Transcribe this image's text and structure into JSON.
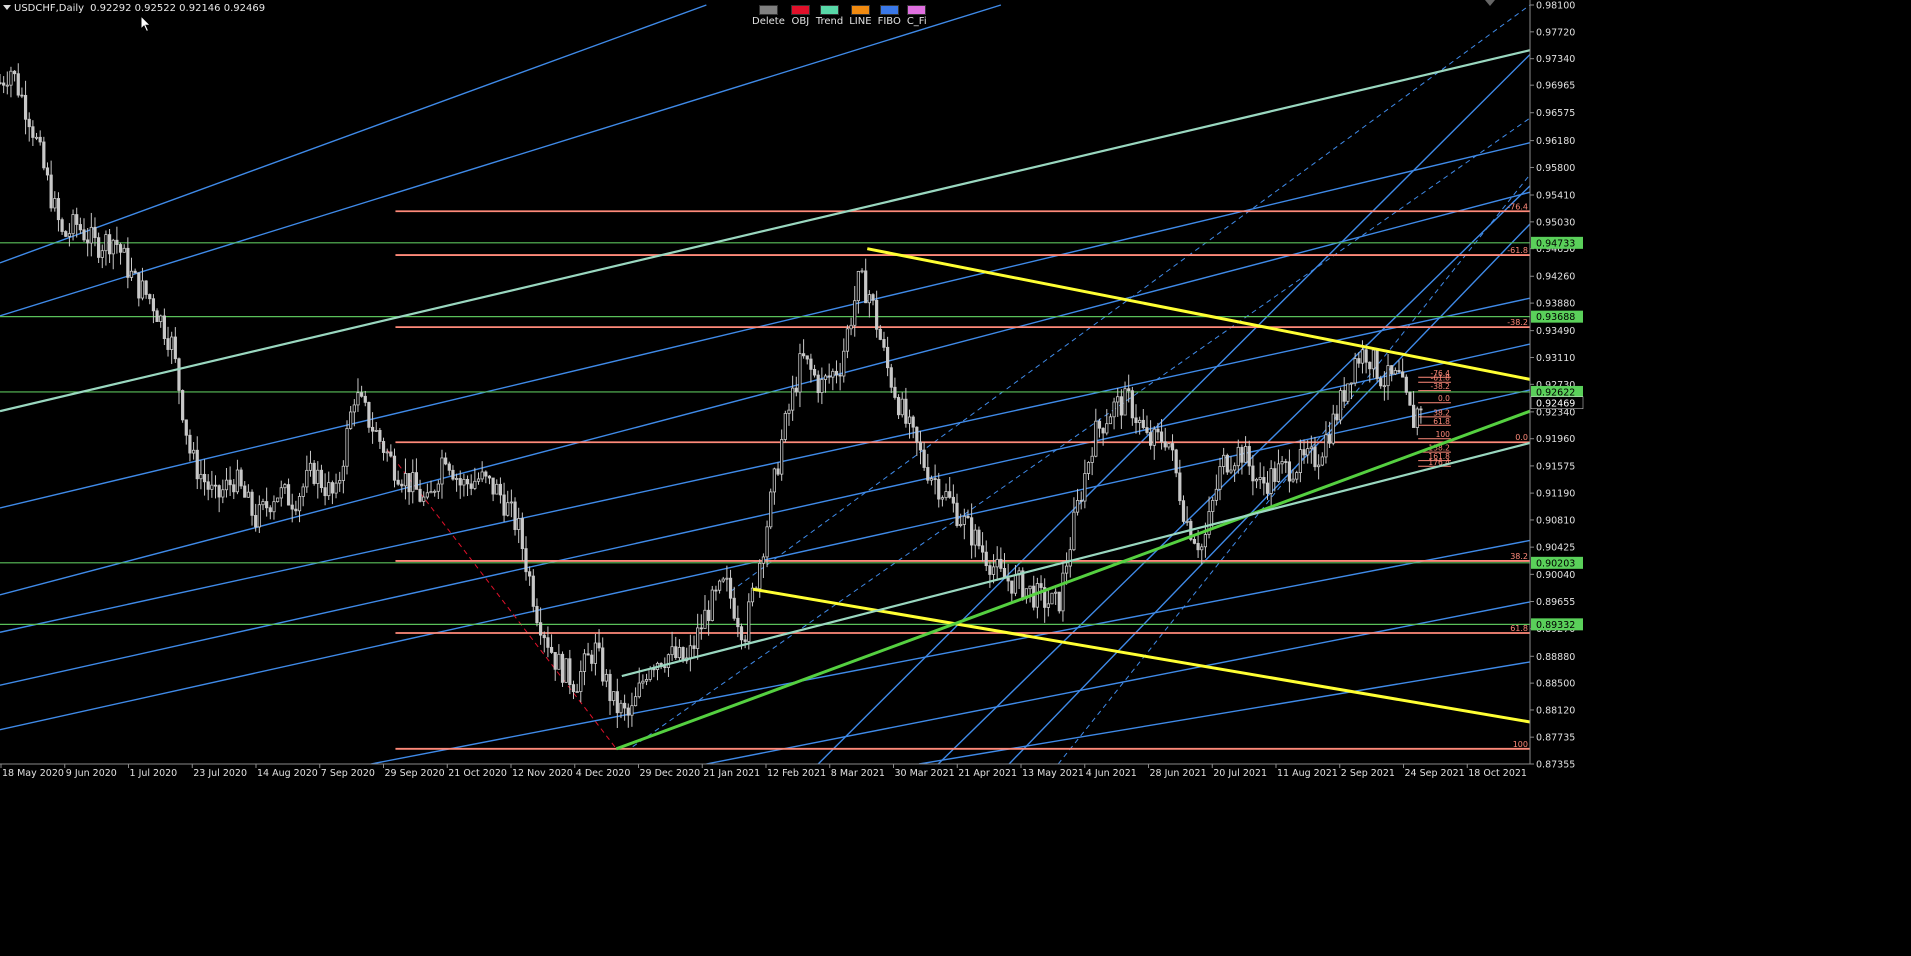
{
  "header": {
    "symbol": "USDCHF,Daily",
    "ohlc": "0.92292 0.92522 0.92146 0.92469"
  },
  "toolbar": {
    "buttons": [
      {
        "label": "Delete",
        "color": "#808080"
      },
      {
        "label": "OBJ",
        "color": "#e0102a"
      },
      {
        "label": "Trend",
        "color": "#58d8a8"
      },
      {
        "label": "LINE",
        "color": "#f08a10"
      },
      {
        "label": "FIBO",
        "color": "#3a78e8"
      },
      {
        "label": "C_Fi",
        "color": "#e070e0"
      }
    ]
  },
  "icons": {
    "cursor": "arrow-cursor-icon",
    "menu": "triangle-menu-icon"
  },
  "colors": {
    "background": "#000000",
    "candles": "#c8c8c8",
    "grid_axis": "#8a8a8a",
    "blue_channel": "#3f8ae8",
    "teal_trend": "#9ad8c0",
    "green_hline": "#5ac05a",
    "salmon_fibo": "#ff8a7a",
    "yellow_trend": "#ffff33",
    "green_trend": "#55d040",
    "price_marker": "#5ad05a"
  },
  "chart_data": {
    "type": "candlestick",
    "title": "",
    "xlabel": "",
    "ylabel": "",
    "ylim": [
      0.87355,
      0.981
    ],
    "y_ticks": [
      "0.98100",
      "0.97720",
      "0.97340",
      "0.96965",
      "0.96575",
      "0.96180",
      "0.95800",
      "0.95410",
      "0.95030",
      "0.94650",
      "0.94260",
      "0.93880",
      "0.93490",
      "0.93110",
      "0.92730",
      "0.92340",
      "0.91960",
      "0.91575",
      "0.91190",
      "0.90810",
      "0.90425",
      "0.90040",
      "0.89655",
      "0.89270",
      "0.88880",
      "0.88500",
      "0.88120",
      "0.87735",
      "0.87355"
    ],
    "x_ticks": [
      "18 May 2020",
      "9 Jun 2020",
      "1 Jul 2020",
      "23 Jul 2020",
      "14 Aug 2020",
      "7 Sep 2020",
      "29 Sep 2020",
      "21 Oct 2020",
      "12 Nov 2020",
      "4 Dec 2020",
      "29 Dec 2020",
      "21 Jan 2021",
      "12 Feb 2021",
      "8 Mar 2021",
      "30 Mar 2021",
      "21 Apr 2021",
      "13 May 2021",
      "4 Jun 2021",
      "28 Jun 2021",
      "20 Jul 2021",
      "11 Aug 2021",
      "2 Sep 2021",
      "24 Sep 2021",
      "18 Oct 2021"
    ],
    "x_range": [
      "2020-05-18",
      "2021-11-30"
    ],
    "close_path": [
      [
        "2020-05-18",
        0.97
      ],
      [
        "2020-05-22",
        0.972
      ],
      [
        "2020-05-29",
        0.965
      ],
      [
        "2020-06-05",
        0.955
      ],
      [
        "2020-06-10",
        0.948
      ],
      [
        "2020-06-15",
        0.95
      ],
      [
        "2020-06-22",
        0.947
      ],
      [
        "2020-06-29",
        0.948
      ],
      [
        "2020-07-06",
        0.942
      ],
      [
        "2020-07-13",
        0.939
      ],
      [
        "2020-07-20",
        0.933
      ],
      [
        "2020-07-27",
        0.917
      ],
      [
        "2020-08-05",
        0.911
      ],
      [
        "2020-08-12",
        0.914
      ],
      [
        "2020-08-20",
        0.908
      ],
      [
        "2020-08-27",
        0.912
      ],
      [
        "2020-09-03",
        0.911
      ],
      [
        "2020-09-10",
        0.915
      ],
      [
        "2020-09-18",
        0.911
      ],
      [
        "2020-09-25",
        0.926
      ],
      [
        "2020-10-02",
        0.921
      ],
      [
        "2020-10-09",
        0.916
      ],
      [
        "2020-10-16",
        0.913
      ],
      [
        "2020-10-22",
        0.91
      ],
      [
        "2020-10-28",
        0.918
      ],
      [
        "2020-11-03",
        0.913
      ],
      [
        "2020-11-10",
        0.914
      ],
      [
        "2020-11-17",
        0.912
      ],
      [
        "2020-11-24",
        0.907
      ],
      [
        "2020-12-01",
        0.895
      ],
      [
        "2020-12-08",
        0.888
      ],
      [
        "2020-12-15",
        0.885
      ],
      [
        "2020-12-22",
        0.89
      ],
      [
        "2020-12-29",
        0.882
      ],
      [
        "2021-01-04",
        0.88
      ],
      [
        "2021-01-11",
        0.888
      ],
      [
        "2021-01-18",
        0.889
      ],
      [
        "2021-01-25",
        0.888
      ],
      [
        "2021-02-01",
        0.895
      ],
      [
        "2021-02-08",
        0.899
      ],
      [
        "2021-02-15",
        0.892
      ],
      [
        "2021-02-22",
        0.905
      ],
      [
        "2021-03-01",
        0.92
      ],
      [
        "2021-03-08",
        0.931
      ],
      [
        "2021-03-15",
        0.927
      ],
      [
        "2021-03-22",
        0.93
      ],
      [
        "2021-03-29",
        0.942
      ],
      [
        "2021-04-02",
        0.94
      ],
      [
        "2021-04-08",
        0.93
      ],
      [
        "2021-04-15",
        0.922
      ],
      [
        "2021-04-22",
        0.916
      ],
      [
        "2021-04-29",
        0.912
      ],
      [
        "2021-05-06",
        0.908
      ],
      [
        "2021-05-13",
        0.904
      ],
      [
        "2021-05-20",
        0.9
      ],
      [
        "2021-05-27",
        0.899
      ],
      [
        "2021-06-03",
        0.897
      ],
      [
        "2021-06-10",
        0.896
      ],
      [
        "2021-06-16",
        0.908
      ],
      [
        "2021-06-23",
        0.92
      ],
      [
        "2021-06-30",
        0.924
      ],
      [
        "2021-07-06",
        0.925
      ],
      [
        "2021-07-13",
        0.919
      ],
      [
        "2021-07-20",
        0.92
      ],
      [
        "2021-07-27",
        0.908
      ],
      [
        "2021-08-02",
        0.904
      ],
      [
        "2021-08-09",
        0.916
      ],
      [
        "2021-08-16",
        0.918
      ],
      [
        "2021-08-23",
        0.913
      ],
      [
        "2021-08-30",
        0.915
      ],
      [
        "2021-09-06",
        0.916
      ],
      [
        "2021-09-13",
        0.917
      ],
      [
        "2021-09-20",
        0.923
      ],
      [
        "2021-09-27",
        0.931
      ],
      [
        "2021-10-01",
        0.932
      ],
      [
        "2021-10-07",
        0.928
      ],
      [
        "2021-10-13",
        0.928
      ],
      [
        "2021-10-18",
        0.922
      ],
      [
        "2021-10-21",
        0.9247
      ]
    ],
    "candle_count": 390,
    "last_price": "0.92469",
    "price_labels": [
      {
        "text": "0.94733",
        "value": 0.94733
      },
      {
        "text": "0.93688",
        "value": 0.93688
      },
      {
        "text": "0.92622",
        "value": 0.92622
      },
      {
        "text": "0.92469",
        "value": 0.92469,
        "kind": "current"
      },
      {
        "text": "0.90203",
        "value": 0.90203
      },
      {
        "text": "0.89332",
        "value": 0.89332
      }
    ],
    "horizontal_lines": [
      {
        "value": 0.94733,
        "color": "#5ac05a"
      },
      {
        "value": 0.93688,
        "color": "#5ac05a"
      },
      {
        "value": 0.92622,
        "color": "#5ac05a"
      },
      {
        "value": 0.90203,
        "color": "#5ac05a"
      },
      {
        "value": 0.89332,
        "color": "#5ac05a"
      }
    ],
    "fibo_large": {
      "start_date": "2020-10-10",
      "end_date": "2021-11-30",
      "levels": [
        {
          "label": "-76.4",
          "value": 0.9518
        },
        {
          "label": "-61.8",
          "value": 0.9456
        },
        {
          "label": "-38.2",
          "value": 0.9354
        },
        {
          "label": "0.0",
          "value": 0.9191
        },
        {
          "label": "38.2",
          "value": 0.9023
        },
        {
          "label": "61.8",
          "value": 0.8921
        },
        {
          "label": "100",
          "value": 0.8757
        }
      ]
    },
    "fibo_small": {
      "start_date": "2021-10-20",
      "end_date": "2021-11-01",
      "levels": [
        {
          "label": "-76.4",
          "value": 0.9283
        },
        {
          "label": "-61.8",
          "value": 0.9276
        },
        {
          "label": "-38.2",
          "value": 0.9264
        },
        {
          "label": "0.0",
          "value": 0.9247
        },
        {
          "label": "38.2",
          "value": 0.9227
        },
        {
          "label": "61.8",
          "value": 0.9215
        },
        {
          "label": "100",
          "value": 0.9196
        },
        {
          "label": "138.2",
          "value": 0.9177
        },
        {
          "label": "161.8",
          "value": 0.9165
        },
        {
          "label": "176.4",
          "value": 0.9157
        }
      ]
    },
    "trendlines": [
      {
        "kind": "yellow",
        "from": [
          "2021-04-01",
          0.9465
        ],
        "to": [
          "2021-11-30",
          0.928
        ]
      },
      {
        "kind": "yellow",
        "from": [
          "2021-02-18",
          0.8983
        ],
        "to": [
          "2021-11-30",
          0.8795
        ]
      },
      {
        "kind": "green",
        "from": [
          "2020-12-30",
          0.8757
        ],
        "to": [
          "2021-11-30",
          0.9235
        ]
      },
      {
        "kind": "teal",
        "from": [
          "2020-05-18",
          0.9235
        ],
        "to": [
          "2021-11-30",
          0.9746
        ]
      },
      {
        "kind": "teal",
        "from": [
          "2021-01-01",
          0.886
        ],
        "to": [
          "2021-11-30",
          0.919
        ]
      }
    ],
    "blue_channels": [
      {
        "from": [
          "2020-05-18",
          0.9445
        ],
        "to": [
          "2021-02-01",
          0.981
        ]
      },
      {
        "from": [
          "2020-05-18",
          0.937
        ],
        "to": [
          "2021-05-20",
          0.981
        ]
      },
      {
        "from": [
          "2020-05-18",
          0.9098
        ],
        "to": [
          "2021-11-30",
          0.9615
        ]
      },
      {
        "from": [
          "2020-05-18",
          0.8975
        ],
        "to": [
          "2021-11-30",
          0.9545
        ]
      },
      {
        "from": [
          "2020-05-18",
          0.8922
        ],
        "to": [
          "2021-11-30",
          0.9395
        ]
      },
      {
        "from": [
          "2020-05-18",
          0.8847
        ],
        "to": [
          "2021-11-30",
          0.933
        ]
      },
      {
        "from": [
          "2020-05-18",
          0.8784
        ],
        "to": [
          "2021-11-30",
          0.9265
        ]
      },
      {
        "from": [
          "2020-10-01",
          0.87355
        ],
        "to": [
          "2021-11-30",
          0.9052
        ]
      },
      {
        "from": [
          "2021-02-01",
          0.87355
        ],
        "to": [
          "2021-11-30",
          0.8965
        ]
      },
      {
        "from": [
          "2021-04-20",
          0.87355
        ],
        "to": [
          "2021-11-30",
          0.888
        ]
      },
      {
        "from": [
          "2021-03-14",
          0.87355
        ],
        "to": [
          "2021-11-30",
          0.974
        ]
      },
      {
        "from": [
          "2021-04-27",
          0.87355
        ],
        "to": [
          "2021-11-30",
          0.9554
        ]
      },
      {
        "from": [
          "2021-05-23",
          0.87355
        ],
        "to": [
          "2021-11-30",
          0.95
        ]
      }
    ],
    "dashed_lines": [
      {
        "from": [
          "2021-02-10",
          0.898
        ],
        "to": [
          "2021-11-30",
          0.981
        ],
        "color": "#3f8ae8"
      },
      {
        "from": [
          "2021-01-05",
          0.876
        ],
        "to": [
          "2021-11-30",
          0.965
        ],
        "color": "#3f8ae8"
      },
      {
        "from": [
          "2021-06-10",
          0.87355
        ],
        "to": [
          "2021-11-30",
          0.957
        ],
        "color": "#3f8ae8"
      },
      {
        "from": [
          "2020-10-05",
          0.919
        ],
        "to": [
          "2020-12-30",
          0.8757
        ],
        "color": "#e0102a"
      }
    ]
  }
}
